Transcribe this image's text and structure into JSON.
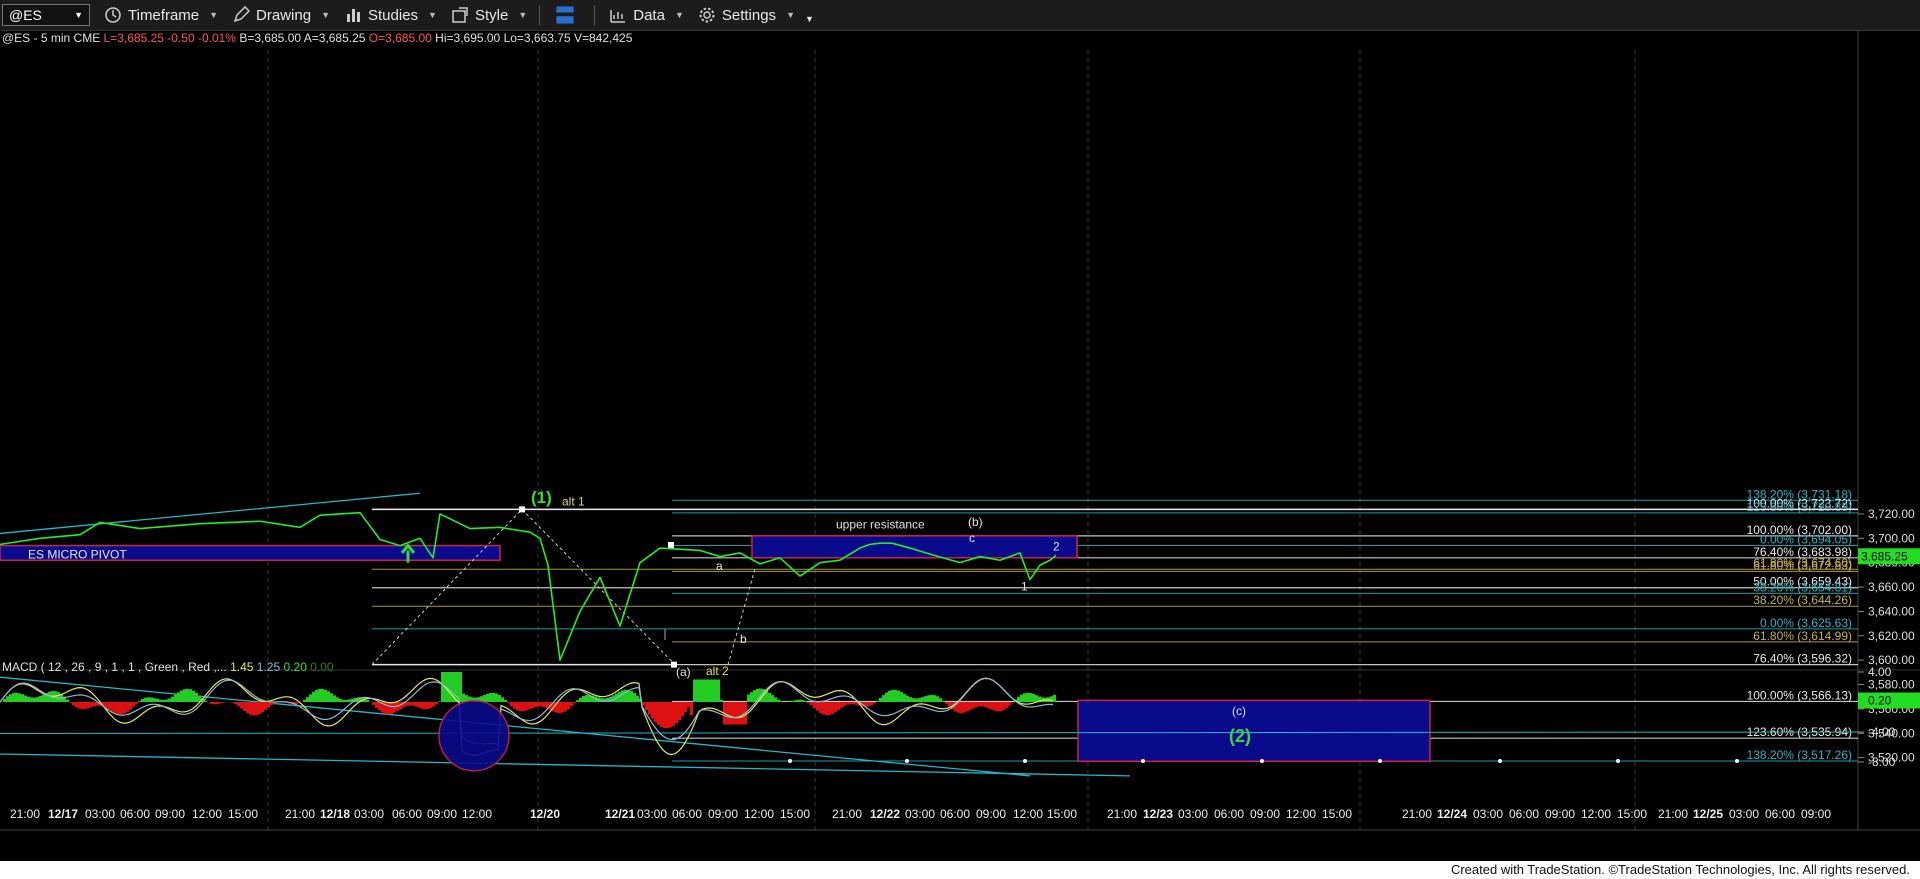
{
  "toolbar": {
    "symbol": "@ES",
    "timeframe": "Timeframe",
    "drawing": "Drawing",
    "studies": "Studies",
    "style": "Style",
    "data": "Data",
    "settings": "Settings"
  },
  "quote": {
    "symbol": "@ES - 5 min CME",
    "last": "L=3,685.25",
    "change": "-0.50",
    "pct": "-0.01%",
    "bid": "B=3,685.00",
    "ask": "A=3,685.25",
    "open": "O=3,685.00",
    "high": "Hi=3,695.00",
    "low": "Lo=3,663.75",
    "volume": "V=842,425"
  },
  "colors": {
    "background": "#000000",
    "price_line": "#22ee22",
    "box_fill": "#0a0a8c",
    "box_border": "#cc2244",
    "cyan": "#22b8c8",
    "fib_gold": "#c8b040",
    "white_line": "#e8e8e8",
    "green_label": "#33dd33",
    "yellow_label": "#e8d84a",
    "macd_line": "#e8e850",
    "signal_line": "#8ab8d8"
  },
  "chart_data": {
    "type": "line",
    "title": "@ES - 5 min CME",
    "ylim": [
      3575,
      3738
    ],
    "y_ticks": [
      "3,720.00",
      "3,700.00",
      "3,680.00",
      "3,660.00",
      "3,640.00",
      "3,620.00",
      "3,600.00",
      "3,580.00",
      "3,560.00",
      "3,540.00",
      "3,520.00"
    ],
    "y_tick_values": [
      3720,
      3700,
      3680,
      3660,
      3640,
      3620,
      3600,
      3580,
      3560,
      3540,
      3520
    ],
    "last_price_label": "3,685.25",
    "last_price": 3685.25,
    "x_ticks": [
      "21:00",
      "12/17",
      "03:00",
      "06:00",
      "09:00",
      "12:00",
      "15:00",
      "21:00",
      "12/18",
      "03:00",
      "06:00",
      "09:00",
      "12:00",
      "12/20",
      "12/21",
      "03:00",
      "06:00",
      "09:00",
      "12:00",
      "15:00",
      "21:00",
      "12/22",
      "03:00",
      "06:00",
      "09:00",
      "12:00",
      "15:00",
      "21:00",
      "12/23",
      "03:00",
      "06:00",
      "09:00",
      "12:00",
      "15:00",
      "21:00",
      "12/24",
      "03:00",
      "06:00",
      "09:00",
      "12:00",
      "15:00",
      "21:00",
      "12/25",
      "03:00",
      "06:00",
      "09:00"
    ],
    "price_series": {
      "name": "@ES",
      "x": [
        0,
        40,
        80,
        100,
        140,
        200,
        260,
        300,
        320,
        360,
        380,
        400,
        420,
        433,
        440,
        470,
        500,
        530,
        540,
        548,
        560,
        580,
        600,
        620,
        640,
        660,
        700,
        720,
        740,
        760,
        780,
        800,
        820,
        840,
        860,
        870,
        880,
        892,
        910,
        930,
        960,
        980,
        1000,
        1020,
        1030,
        1040,
        1050,
        1056
      ],
      "y": [
        3695,
        3700,
        3703,
        3713,
        3708,
        3712,
        3714,
        3709,
        3719,
        3721,
        3699,
        3694,
        3700,
        3684,
        3720,
        3708,
        3709,
        3705,
        3700,
        3678,
        3600,
        3640,
        3668,
        3628,
        3680,
        3692,
        3690,
        3685,
        3688,
        3679,
        3684,
        3669,
        3680,
        3682,
        3692,
        3695,
        3696,
        3696,
        3692,
        3687,
        3680,
        3685,
        3682,
        3688,
        3666,
        3678,
        3682,
        3686
      ]
    },
    "fib_levels": [
      {
        "label": "138.20% (3,731.18)",
        "value": 3731.18,
        "color": "cyan"
      },
      {
        "label": "100.00% (3,723.72)",
        "value": 3723.72,
        "color": "white"
      },
      {
        "label": "123.60% (3,720.83)",
        "value": 3720.83,
        "color": "cyan"
      },
      {
        "label": "100.00% (3,702.00)",
        "value": 3702.0,
        "color": "white"
      },
      {
        "label": "0.00% (3,694.05)",
        "value": 3694.05,
        "color": "cyan"
      },
      {
        "label": "76.40% (3,683.98)",
        "value": 3683.98,
        "color": "white"
      },
      {
        "label": "61.80% (3,674.60)",
        "value": 3674.6,
        "color": "gold"
      },
      {
        "label": "61.80% (3,672.83)",
        "value": 3672.83,
        "color": "gold"
      },
      {
        "label": "50.00% (3,659.43)",
        "value": 3659.43,
        "color": "white"
      },
      {
        "label": "38.20% (3,654.81)",
        "value": 3654.81,
        "color": "cyan"
      },
      {
        "label": "38.20% (3,644.26)",
        "value": 3644.26,
        "color": "gold"
      },
      {
        "label": "0.00% (3,625.63)",
        "value": 3625.63,
        "color": "cyan"
      },
      {
        "label": "61.80% (3,614.99)",
        "value": 3614.99,
        "color": "gold"
      },
      {
        "label": "76.40% (3,596.32)",
        "value": 3596.32,
        "color": "white"
      },
      {
        "label": "100.00% (3,566.13)",
        "value": 3566.13,
        "color": "white"
      },
      {
        "label": "123.60% (3,535.94)",
        "value": 3535.94,
        "color": "white"
      },
      {
        "label": "138.20% (3,517.26)",
        "value": 3517.26,
        "color": "cyan"
      }
    ],
    "annotations": [
      {
        "text": "(1)",
        "color": "green"
      },
      {
        "text": "alt 1",
        "color": "yellow"
      },
      {
        "text": "upper resistance",
        "color": "white"
      },
      {
        "text": "(b)",
        "color": "white"
      },
      {
        "text": "c",
        "color": "white"
      },
      {
        "text": "2",
        "color": "white"
      },
      {
        "text": "a",
        "color": "white"
      },
      {
        "text": "1",
        "color": "white"
      },
      {
        "text": "b",
        "color": "white"
      },
      {
        "text": "(a)",
        "color": "white"
      },
      {
        "text": "alt 2",
        "color": "yellow"
      },
      {
        "text": "(c)",
        "color": "white"
      },
      {
        "text": "(2)",
        "color": "green"
      },
      {
        "text": "ES MICRO PIVOT",
        "color": "white"
      }
    ],
    "macd": {
      "label": "MACD ( 12 , 26 , 9 , 1 , 1 , Green , Red ,...",
      "values": [
        "1.45",
        "1.25",
        "0.20",
        "0.00"
      ],
      "y_ticks": [
        "4.00",
        "-4.00",
        "-8.00"
      ],
      "last_label": "0.20",
      "ylim": [
        -10,
        6
      ]
    }
  },
  "footer": "Created with TradeStation. ©TradeStation Technologies, Inc. All rights reserved."
}
